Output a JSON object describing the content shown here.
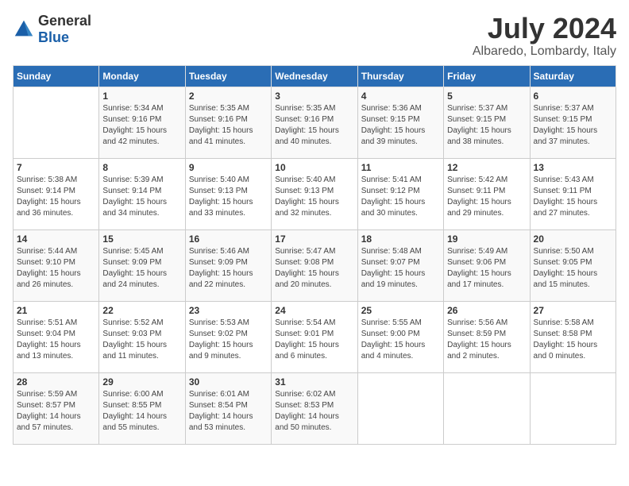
{
  "header": {
    "logo_general": "General",
    "logo_blue": "Blue",
    "month_year": "July 2024",
    "location": "Albaredo, Lombardy, Italy"
  },
  "weekdays": [
    "Sunday",
    "Monday",
    "Tuesday",
    "Wednesday",
    "Thursday",
    "Friday",
    "Saturday"
  ],
  "weeks": [
    [
      null,
      {
        "day": 1,
        "sunrise": "5:34 AM",
        "sunset": "9:16 PM",
        "daylight": "15 hours and 42 minutes."
      },
      {
        "day": 2,
        "sunrise": "5:35 AM",
        "sunset": "9:16 PM",
        "daylight": "15 hours and 41 minutes."
      },
      {
        "day": 3,
        "sunrise": "5:35 AM",
        "sunset": "9:16 PM",
        "daylight": "15 hours and 40 minutes."
      },
      {
        "day": 4,
        "sunrise": "5:36 AM",
        "sunset": "9:15 PM",
        "daylight": "15 hours and 39 minutes."
      },
      {
        "day": 5,
        "sunrise": "5:37 AM",
        "sunset": "9:15 PM",
        "daylight": "15 hours and 38 minutes."
      },
      {
        "day": 6,
        "sunrise": "5:37 AM",
        "sunset": "9:15 PM",
        "daylight": "15 hours and 37 minutes."
      }
    ],
    [
      {
        "day": 7,
        "sunrise": "5:38 AM",
        "sunset": "9:14 PM",
        "daylight": "15 hours and 36 minutes."
      },
      {
        "day": 8,
        "sunrise": "5:39 AM",
        "sunset": "9:14 PM",
        "daylight": "15 hours and 34 minutes."
      },
      {
        "day": 9,
        "sunrise": "5:40 AM",
        "sunset": "9:13 PM",
        "daylight": "15 hours and 33 minutes."
      },
      {
        "day": 10,
        "sunrise": "5:40 AM",
        "sunset": "9:13 PM",
        "daylight": "15 hours and 32 minutes."
      },
      {
        "day": 11,
        "sunrise": "5:41 AM",
        "sunset": "9:12 PM",
        "daylight": "15 hours and 30 minutes."
      },
      {
        "day": 12,
        "sunrise": "5:42 AM",
        "sunset": "9:11 PM",
        "daylight": "15 hours and 29 minutes."
      },
      {
        "day": 13,
        "sunrise": "5:43 AM",
        "sunset": "9:11 PM",
        "daylight": "15 hours and 27 minutes."
      }
    ],
    [
      {
        "day": 14,
        "sunrise": "5:44 AM",
        "sunset": "9:10 PM",
        "daylight": "15 hours and 26 minutes."
      },
      {
        "day": 15,
        "sunrise": "5:45 AM",
        "sunset": "9:09 PM",
        "daylight": "15 hours and 24 minutes."
      },
      {
        "day": 16,
        "sunrise": "5:46 AM",
        "sunset": "9:09 PM",
        "daylight": "15 hours and 22 minutes."
      },
      {
        "day": 17,
        "sunrise": "5:47 AM",
        "sunset": "9:08 PM",
        "daylight": "15 hours and 20 minutes."
      },
      {
        "day": 18,
        "sunrise": "5:48 AM",
        "sunset": "9:07 PM",
        "daylight": "15 hours and 19 minutes."
      },
      {
        "day": 19,
        "sunrise": "5:49 AM",
        "sunset": "9:06 PM",
        "daylight": "15 hours and 17 minutes."
      },
      {
        "day": 20,
        "sunrise": "5:50 AM",
        "sunset": "9:05 PM",
        "daylight": "15 hours and 15 minutes."
      }
    ],
    [
      {
        "day": 21,
        "sunrise": "5:51 AM",
        "sunset": "9:04 PM",
        "daylight": "15 hours and 13 minutes."
      },
      {
        "day": 22,
        "sunrise": "5:52 AM",
        "sunset": "9:03 PM",
        "daylight": "15 hours and 11 minutes."
      },
      {
        "day": 23,
        "sunrise": "5:53 AM",
        "sunset": "9:02 PM",
        "daylight": "15 hours and 9 minutes."
      },
      {
        "day": 24,
        "sunrise": "5:54 AM",
        "sunset": "9:01 PM",
        "daylight": "15 hours and 6 minutes."
      },
      {
        "day": 25,
        "sunrise": "5:55 AM",
        "sunset": "9:00 PM",
        "daylight": "15 hours and 4 minutes."
      },
      {
        "day": 26,
        "sunrise": "5:56 AM",
        "sunset": "8:59 PM",
        "daylight": "15 hours and 2 minutes."
      },
      {
        "day": 27,
        "sunrise": "5:58 AM",
        "sunset": "8:58 PM",
        "daylight": "15 hours and 0 minutes."
      }
    ],
    [
      {
        "day": 28,
        "sunrise": "5:59 AM",
        "sunset": "8:57 PM",
        "daylight": "14 hours and 57 minutes."
      },
      {
        "day": 29,
        "sunrise": "6:00 AM",
        "sunset": "8:55 PM",
        "daylight": "14 hours and 55 minutes."
      },
      {
        "day": 30,
        "sunrise": "6:01 AM",
        "sunset": "8:54 PM",
        "daylight": "14 hours and 53 minutes."
      },
      {
        "day": 31,
        "sunrise": "6:02 AM",
        "sunset": "8:53 PM",
        "daylight": "14 hours and 50 minutes."
      },
      null,
      null,
      null
    ]
  ]
}
